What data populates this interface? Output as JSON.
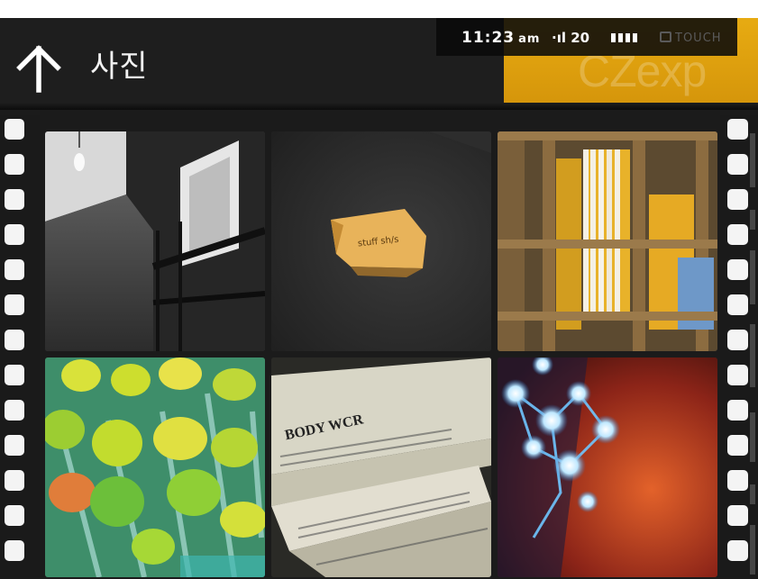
{
  "status_bar": {
    "time": "11:23",
    "time_suffix": "am",
    "signal": "·ıl 20",
    "touch_label": "TOUCH"
  },
  "header": {
    "title": "사진",
    "back_icon": "arrow-up-icon",
    "brand_text": "CZexp"
  },
  "photos": [
    {
      "name": "photo-hallway",
      "subject": "dim hallway with hanging bulb"
    },
    {
      "name": "photo-note",
      "subject": "yellow note on dark wall",
      "note_text": "stuff sh/s"
    },
    {
      "name": "photo-bookshelf",
      "subject": "bookshelf with yellow spines"
    },
    {
      "name": "photo-green-pins",
      "subject": "green and yellow pins"
    },
    {
      "name": "photo-newspapers",
      "subject": "stack of newspapers",
      "headline": "BODY WCR"
    },
    {
      "name": "photo-lights",
      "subject": "blue lights over red wall"
    }
  ],
  "colors": {
    "accent": "#e0a20f",
    "background": "#1b1b1b"
  }
}
